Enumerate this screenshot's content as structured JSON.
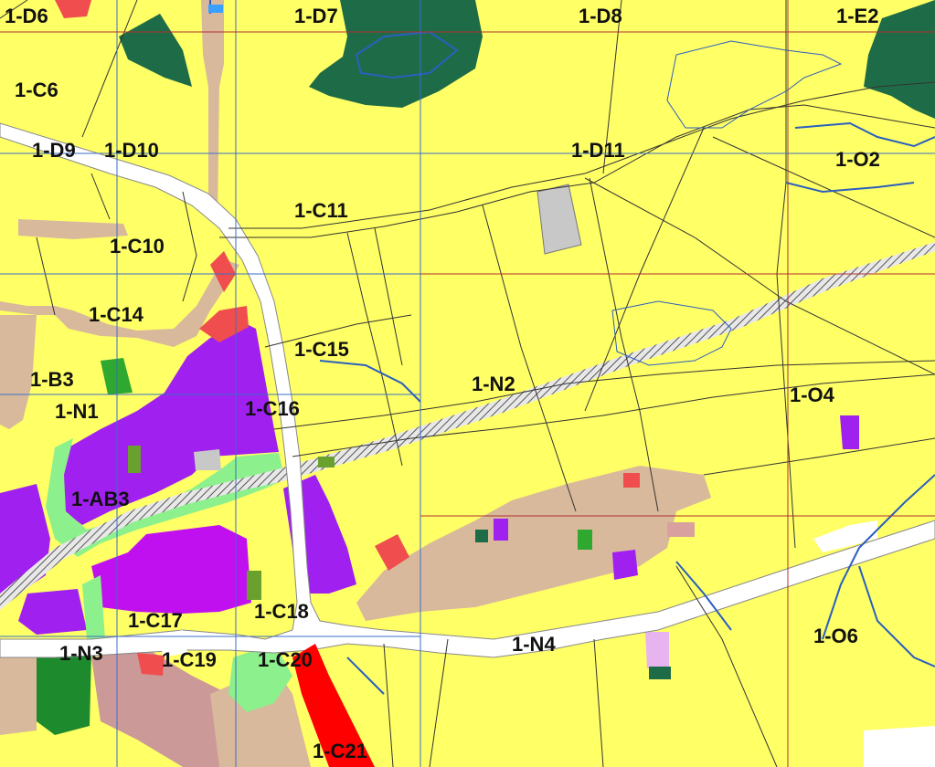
{
  "map": {
    "zone_labels": [
      "1-D6",
      "1-D7",
      "1-D8",
      "1-E2",
      "1-C6",
      "1-D9",
      "1-D10",
      "1-D11",
      "1-O2",
      "1-C11",
      "1-C10",
      "1-C14",
      "1-C15",
      "1-B3",
      "1-N2",
      "1-O4",
      "1-N1",
      "1-C16",
      "1-AB3",
      "1-C17",
      "1-C18",
      "1-N3",
      "1-C19",
      "1-C20",
      "1-N4",
      "1-O6",
      "1-C21"
    ],
    "legend_colors": {
      "agricultural": "#ffff66",
      "residential": "#d9b99b",
      "commercial_service": "#a020f0",
      "forest": "#1e6b47",
      "green_space": "#8cf08c",
      "road": "#ffffff",
      "infrastructure": "#ff0000",
      "industrial_red": "#f04e4e",
      "grey_facility": "#c8c8c8",
      "water_line": "#2b5fbf",
      "grid_blue": "#3a6ec8",
      "grid_red": "#b03030"
    }
  }
}
